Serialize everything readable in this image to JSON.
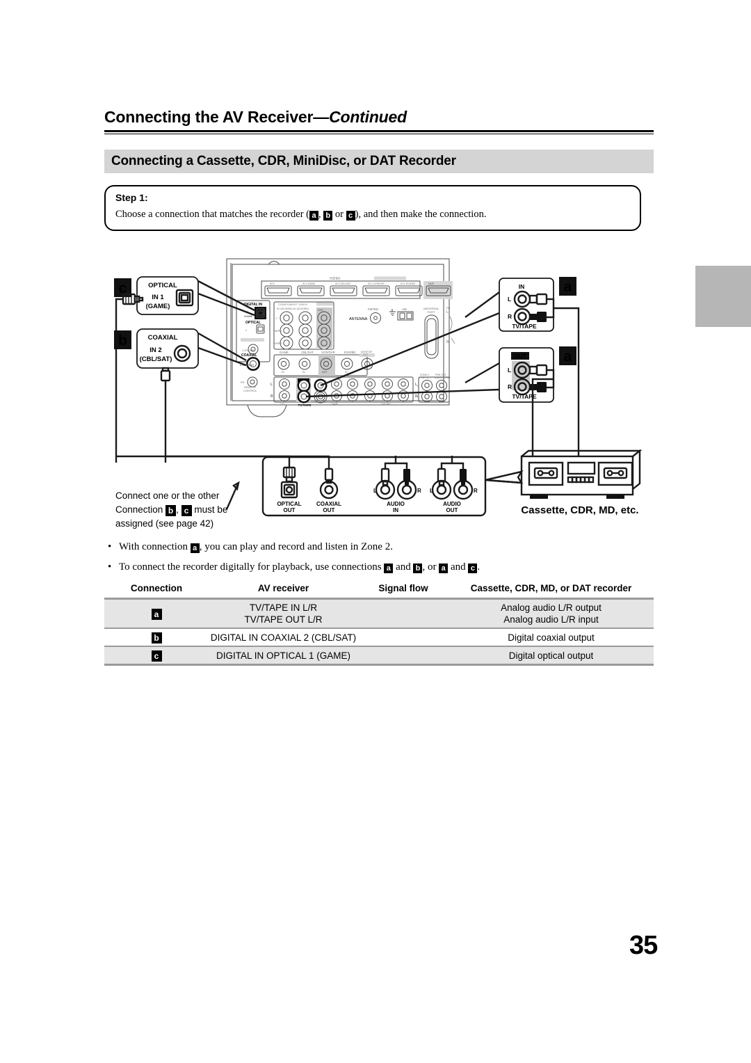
{
  "header": {
    "title_main": "Connecting the AV Receiver",
    "title_sep": "—",
    "title_cont": "Continued",
    "subhead": "Connecting a Cassette, CDR, MiniDisc, or DAT Recorder"
  },
  "step": {
    "label": "Step 1:",
    "text_a": "Choose a connection that matches the recorder (",
    "chip_a": "a",
    "text_b": ", ",
    "chip_b": "b",
    "text_c": " or ",
    "chip_c": "c",
    "text_d": "), and then make the connection."
  },
  "diagram": {
    "callout_c": {
      "badge": "c",
      "line1": "OPTICAL",
      "line2": "IN 1",
      "line3": "(GAME)"
    },
    "callout_b": {
      "badge": "b",
      "line1": "COAXIAL",
      "line2": "IN 2",
      "line3": "(CBL/SAT)"
    },
    "callout_a_in": {
      "badge": "a",
      "header": "IN",
      "left": "L",
      "right": "R",
      "footer": "TV/TAPE"
    },
    "callout_a_out": {
      "badge": "a",
      "header": "OUT",
      "left": "L",
      "right": "R",
      "footer": "TV/TAPE"
    },
    "receiver_panel": {
      "digital_in": "DIGITAL IN",
      "optical": "OPTICAL",
      "coaxial": "COAXIAL",
      "game": "GAME",
      "cblsat": "CBL/SAT",
      "remote_control": "REMOTE CONTROL",
      "hdmi": "HDMI",
      "component": "COMPONENT VIDEO",
      "antenna": "ANTENNA",
      "fm75": "FM75Ω",
      "am": "AM",
      "universal_port": "UNIVERSAL PORT",
      "tv_tape": "TV/TAPE",
      "cd": "CD",
      "zone2_line_out": "ZONE 2 LINE OUT",
      "pre_out_subwoofer": "PRE OUT SUBWOOFER",
      "monitor_out": "MONITOR OUT",
      "in_label": "IN",
      "out_label": "OUT",
      "l_label": "L",
      "r_label": "R",
      "sources": [
        "GAME",
        "CBL/SAT",
        "VCR/DVR",
        "DVD/BD"
      ]
    },
    "recorder_panel": {
      "optical_out_l1": "OPTICAL",
      "optical_out_l2": "OUT",
      "coaxial_out_l1": "COAXIAL",
      "coaxial_out_l2": "OUT",
      "audio_in_l1": "AUDIO",
      "audio_in_l2": "IN",
      "audio_out_l1": "AUDIO",
      "audio_out_l2": "OUT",
      "left": "L",
      "right": "R"
    },
    "device_caption": "Cassette, CDR, MD, etc."
  },
  "notes": {
    "note_line1": "Connect one or the other",
    "note_line2_pre": "Connection ",
    "note_chip_b": "b",
    "note_line2_mid": ", ",
    "note_chip_c": "c",
    "note_line2_post": " must be",
    "note_line3": "assigned (see page 42)",
    "bullet1_pre": "With connection ",
    "bullet1_chip": "a",
    "bullet1_post": ", you can play and record and listen in Zone 2.",
    "bullet2_pre": "To connect the recorder digitally for playback, use connections ",
    "bullet2_chip1": "a",
    "bullet2_mid1": " and ",
    "bullet2_chip2": "b",
    "bullet2_mid2": ", or ",
    "bullet2_chip3": "a",
    "bullet2_mid3": " and ",
    "bullet2_chip4": "c",
    "bullet2_post": "."
  },
  "table": {
    "headers": [
      "Connection",
      "AV receiver",
      "Signal flow",
      "Cassette, CDR, MD, or DAT recorder"
    ],
    "rows": [
      {
        "connection": "a",
        "av_receiver_line1": "TV/TAPE IN L/R",
        "av_receiver_line2": "TV/TAPE OUT L/R",
        "signal_flow": "",
        "recorder_line1": "Analog audio L/R output",
        "recorder_line2": "Analog audio L/R input"
      },
      {
        "connection": "b",
        "av_receiver_line1": "DIGITAL IN COAXIAL 2 (CBL/SAT)",
        "av_receiver_line2": "",
        "signal_flow": "",
        "recorder_line1": "Digital coaxial output",
        "recorder_line2": ""
      },
      {
        "connection": "c",
        "av_receiver_line1": "DIGITAL IN OPTICAL 1 (GAME)",
        "av_receiver_line2": "",
        "signal_flow": "",
        "recorder_line1": "Digital optical output",
        "recorder_line2": ""
      }
    ]
  },
  "page_number": "35"
}
